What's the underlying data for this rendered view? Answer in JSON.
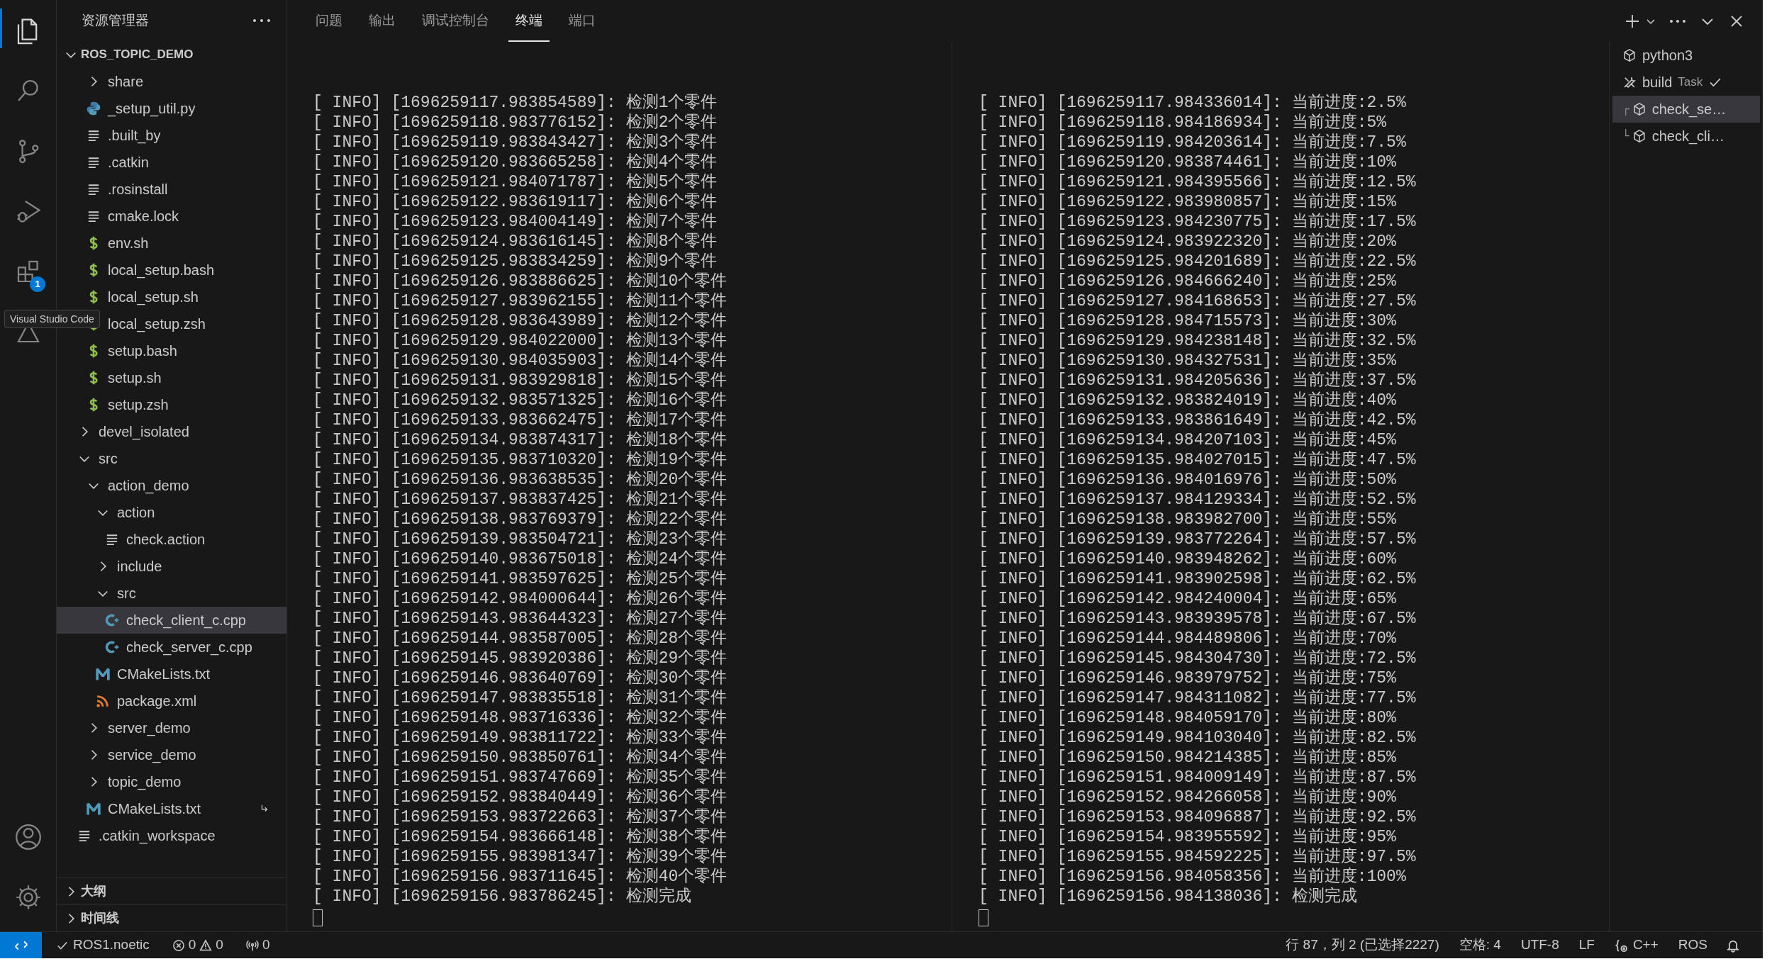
{
  "activity_bar": {
    "top": [
      {
        "kind": "explorer",
        "selected": true
      },
      {
        "kind": "search",
        "selected": false
      },
      {
        "kind": "source_control",
        "selected": false
      },
      {
        "kind": "run_debug",
        "selected": false
      },
      {
        "kind": "extensions",
        "selected": false,
        "badge": "1"
      },
      {
        "kind": "testing",
        "selected": false
      }
    ],
    "bottom": [
      {
        "kind": "accounts"
      },
      {
        "kind": "settings"
      }
    ]
  },
  "tooltip": {
    "text": "Visual Studio Code"
  },
  "explorer": {
    "title": "资源管理器",
    "root": {
      "label": "ROS_TOPIC_DEMO",
      "expanded": true,
      "children": [
        {
          "kind": "continuation",
          "children": [
            {
              "kind": "folder",
              "label": "share",
              "expanded": false,
              "selected": false
            },
            {
              "kind": "python",
              "label": "_setup_util.py",
              "selected": false
            },
            {
              "kind": "text",
              "label": ".built_by",
              "selected": false
            },
            {
              "kind": "text",
              "label": ".catkin",
              "selected": false
            },
            {
              "kind": "text",
              "label": ".rosinstall",
              "selected": false
            },
            {
              "kind": "text",
              "label": "cmake.lock",
              "selected": false
            },
            {
              "kind": "shell",
              "label": "env.sh",
              "selected": false
            },
            {
              "kind": "shell",
              "label": "local_setup.bash",
              "selected": false
            },
            {
              "kind": "shell",
              "label": "local_setup.sh",
              "selected": false
            },
            {
              "kind": "shell",
              "label": "local_setup.zsh",
              "selected": false
            },
            {
              "kind": "shell",
              "label": "setup.bash",
              "selected": false
            },
            {
              "kind": "shell",
              "label": "setup.sh",
              "selected": false
            },
            {
              "kind": "shell",
              "label": "setup.zsh",
              "selected": false
            }
          ]
        },
        {
          "kind": "folder",
          "label": "devel_isolated",
          "expanded": false,
          "selected": false
        },
        {
          "kind": "folder",
          "label": "src",
          "expanded": true,
          "selected": false,
          "children": [
            {
              "kind": "folder",
              "label": "action_demo",
              "expanded": true,
              "selected": false,
              "children": [
                {
                  "kind": "folder",
                  "label": "action",
                  "expanded": true,
                  "selected": false,
                  "children": [
                    {
                      "kind": "text",
                      "label": "check.action",
                      "selected": false
                    }
                  ]
                },
                {
                  "kind": "folder",
                  "label": "include",
                  "expanded": false,
                  "selected": false
                },
                {
                  "kind": "folder",
                  "label": "src",
                  "expanded": true,
                  "selected": false,
                  "children": [
                    {
                      "kind": "cpp",
                      "label": "check_client_c.cpp",
                      "selected": true
                    },
                    {
                      "kind": "cpp",
                      "label": "check_server_c.cpp",
                      "selected": false
                    }
                  ]
                },
                {
                  "kind": "cmake",
                  "label": "CMakeLists.txt",
                  "selected": false
                },
                {
                  "kind": "xml",
                  "label": "package.xml",
                  "selected": false
                }
              ]
            },
            {
              "kind": "folder",
              "label": "server_demo",
              "expanded": false,
              "selected": false
            },
            {
              "kind": "folder",
              "label": "service_demo",
              "expanded": false,
              "selected": false
            },
            {
              "kind": "folder",
              "label": "topic_demo",
              "expanded": false,
              "selected": false
            },
            {
              "kind": "cmake",
              "label": "CMakeLists.txt",
              "selected": false,
              "symlink": true
            }
          ]
        },
        {
          "kind": "text",
          "label": ".catkin_workspace",
          "selected": false
        }
      ]
    },
    "sections": [
      {
        "label": "大纲",
        "expanded": false
      },
      {
        "label": "时间线",
        "expanded": false
      }
    ]
  },
  "panel": {
    "tabs": [
      {
        "label": "问题",
        "selected": false
      },
      {
        "label": "输出",
        "selected": false
      },
      {
        "label": "调试控制台",
        "selected": false
      },
      {
        "label": "终端",
        "selected": true
      },
      {
        "label": "端口",
        "selected": false
      }
    ],
    "terminals": [
      {
        "cursor": true,
        "lines": [
          "[ INFO] [1696259117.983854589]: 检测1个零件",
          "[ INFO] [1696259118.983776152]: 检测2个零件",
          "[ INFO] [1696259119.983843427]: 检测3个零件",
          "[ INFO] [1696259120.983665258]: 检测4个零件",
          "[ INFO] [1696259121.984071787]: 检测5个零件",
          "[ INFO] [1696259122.983619117]: 检测6个零件",
          "[ INFO] [1696259123.984004149]: 检测7个零件",
          "[ INFO] [1696259124.983616145]: 检测8个零件",
          "[ INFO] [1696259125.983834259]: 检测9个零件",
          "[ INFO] [1696259126.983886625]: 检测10个零件",
          "[ INFO] [1696259127.983962155]: 检测11个零件",
          "[ INFO] [1696259128.983643989]: 检测12个零件",
          "[ INFO] [1696259129.984022000]: 检测13个零件",
          "[ INFO] [1696259130.984035903]: 检测14个零件",
          "[ INFO] [1696259131.983929818]: 检测15个零件",
          "[ INFO] [1696259132.983571325]: 检测16个零件",
          "[ INFO] [1696259133.983662475]: 检测17个零件",
          "[ INFO] [1696259134.983874317]: 检测18个零件",
          "[ INFO] [1696259135.983710320]: 检测19个零件",
          "[ INFO] [1696259136.983638535]: 检测20个零件",
          "[ INFO] [1696259137.983837425]: 检测21个零件",
          "[ INFO] [1696259138.983769379]: 检测22个零件",
          "[ INFO] [1696259139.983504721]: 检测23个零件",
          "[ INFO] [1696259140.983675018]: 检测24个零件",
          "[ INFO] [1696259141.983597625]: 检测25个零件",
          "[ INFO] [1696259142.984000644]: 检测26个零件",
          "[ INFO] [1696259143.983644323]: 检测27个零件",
          "[ INFO] [1696259144.983587005]: 检测28个零件",
          "[ INFO] [1696259145.983920386]: 检测29个零件",
          "[ INFO] [1696259146.983640769]: 检测30个零件",
          "[ INFO] [1696259147.983835518]: 检测31个零件",
          "[ INFO] [1696259148.983716336]: 检测32个零件",
          "[ INFO] [1696259149.983811722]: 检测33个零件",
          "[ INFO] [1696259150.983850761]: 检测34个零件",
          "[ INFO] [1696259151.983747669]: 检测35个零件",
          "[ INFO] [1696259152.983840449]: 检测36个零件",
          "[ INFO] [1696259153.983722663]: 检测37个零件",
          "[ INFO] [1696259154.983666148]: 检测38个零件",
          "[ INFO] [1696259155.983981347]: 检测39个零件",
          "[ INFO] [1696259156.983711645]: 检测40个零件",
          "[ INFO] [1696259156.983786245]: 检测完成"
        ]
      },
      {
        "cursor": true,
        "lines": [
          "[ INFO] [1696259117.984336014]: 当前进度:2.5%",
          "[ INFO] [1696259118.984186934]: 当前进度:5%",
          "[ INFO] [1696259119.984203614]: 当前进度:7.5%",
          "[ INFO] [1696259120.983874461]: 当前进度:10%",
          "[ INFO] [1696259121.984395566]: 当前进度:12.5%",
          "[ INFO] [1696259122.983980857]: 当前进度:15%",
          "[ INFO] [1696259123.984230775]: 当前进度:17.5%",
          "[ INFO] [1696259124.983922320]: 当前进度:20%",
          "[ INFO] [1696259125.984201689]: 当前进度:22.5%",
          "[ INFO] [1696259126.984666240]: 当前进度:25%",
          "[ INFO] [1696259127.984168653]: 当前进度:27.5%",
          "[ INFO] [1696259128.984715573]: 当前进度:30%",
          "[ INFO] [1696259129.984238148]: 当前进度:32.5%",
          "[ INFO] [1696259130.984327531]: 当前进度:35%",
          "[ INFO] [1696259131.984205636]: 当前进度:37.5%",
          "[ INFO] [1696259132.983824019]: 当前进度:40%",
          "[ INFO] [1696259133.983861649]: 当前进度:42.5%",
          "[ INFO] [1696259134.984207103]: 当前进度:45%",
          "[ INFO] [1696259135.984027015]: 当前进度:47.5%",
          "[ INFO] [1696259136.984016976]: 当前进度:50%",
          "[ INFO] [1696259137.984129334]: 当前进度:52.5%",
          "[ INFO] [1696259138.983982700]: 当前进度:55%",
          "[ INFO] [1696259139.983772264]: 当前进度:57.5%",
          "[ INFO] [1696259140.983948262]: 当前进度:60%",
          "[ INFO] [1696259141.983902598]: 当前进度:62.5%",
          "[ INFO] [1696259142.984240004]: 当前进度:65%",
          "[ INFO] [1696259143.983939578]: 当前进度:67.5%",
          "[ INFO] [1696259144.984489806]: 当前进度:70%",
          "[ INFO] [1696259145.984304730]: 当前进度:72.5%",
          "[ INFO] [1696259146.983979752]: 当前进度:75%",
          "[ INFO] [1696259147.984311082]: 当前进度:77.5%",
          "[ INFO] [1696259148.984059170]: 当前进度:80%",
          "[ INFO] [1696259149.984103040]: 当前进度:82.5%",
          "[ INFO] [1696259150.984214385]: 当前进度:85%",
          "[ INFO] [1696259151.984009149]: 当前进度:87.5%",
          "[ INFO] [1696259152.984266058]: 当前进度:90%",
          "[ INFO] [1696259153.984096887]: 当前进度:92.5%",
          "[ INFO] [1696259154.983955592]: 当前进度:95%",
          "[ INFO] [1696259155.984592225]: 当前进度:97.5%",
          "[ INFO] [1696259156.984058356]: 当前进度:100%",
          "[ INFO] [1696259156.984138036]: 检测完成"
        ]
      }
    ],
    "terminal_list": [
      {
        "kind": "terminal",
        "label": "python3",
        "selected": false
      },
      {
        "kind": "task",
        "label": "build",
        "detail": "Task",
        "done": true,
        "selected": false
      },
      {
        "kind": "terminal",
        "label": "check_se…",
        "connector": "┌",
        "selected": true
      },
      {
        "kind": "terminal",
        "label": "check_cli…",
        "connector": "└",
        "selected": false
      }
    ]
  },
  "status_bar": {
    "left": [
      {
        "kind": "remote"
      },
      {
        "kind": "check",
        "text": "ROS1.noetic"
      },
      {
        "kind": "problems",
        "errors": "0",
        "warnings": "0"
      },
      {
        "kind": "ports",
        "text": "0"
      }
    ],
    "right": [
      {
        "kind": "text",
        "text": "行 87，列 2 (已选择2227)"
      },
      {
        "kind": "text",
        "text": "空格: 4"
      },
      {
        "kind": "text",
        "text": "UTF-8"
      },
      {
        "kind": "text",
        "text": "LF"
      },
      {
        "kind": "language",
        "text": "C++"
      },
      {
        "kind": "text",
        "text": "ROS"
      },
      {
        "kind": "bell"
      }
    ]
  }
}
